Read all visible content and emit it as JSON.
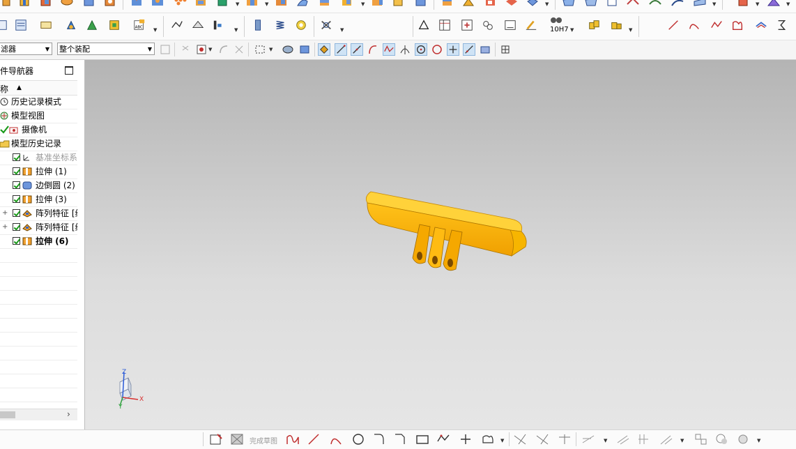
{
  "colors": {
    "accent": "#1a9a1a",
    "part": "#f5b800",
    "viewport_top": "#b4b4b4",
    "viewport_bottom": "#e6e6e6"
  },
  "toolbar": {
    "filter_select": {
      "value": "滤器"
    },
    "assembly_select": {
      "value": "整个装配"
    },
    "tolerance_label": "10H7"
  },
  "navigator": {
    "title": "件导航器",
    "column_header": "称",
    "items": [
      {
        "label": "历史记录模式",
        "icon": "clock-icon"
      },
      {
        "label": "模型视图",
        "icon": "model-views-icon"
      },
      {
        "label": "摄像机",
        "icon": "camera-icon"
      },
      {
        "label": "模型历史记录",
        "icon": "folder-icon"
      },
      {
        "label": "基准坐标系",
        "icon": "datum-csys-icon"
      },
      {
        "label": "拉伸 (1)",
        "icon": "extrude-icon"
      },
      {
        "label": "边倒圆 (2)",
        "icon": "edge-blend-icon"
      },
      {
        "label": "拉伸 (3)",
        "icon": "extrude-icon"
      },
      {
        "label": "阵列特征 [线",
        "icon": "pattern-icon"
      },
      {
        "label": "阵列特征 [线",
        "icon": "pattern-icon"
      },
      {
        "label": "拉伸 (6)",
        "icon": "extrude-icon"
      }
    ]
  },
  "triad": {
    "z": "Z",
    "x": "X",
    "y": "Y"
  },
  "bottom_bar": {
    "finish_sketch": "完成草图"
  }
}
